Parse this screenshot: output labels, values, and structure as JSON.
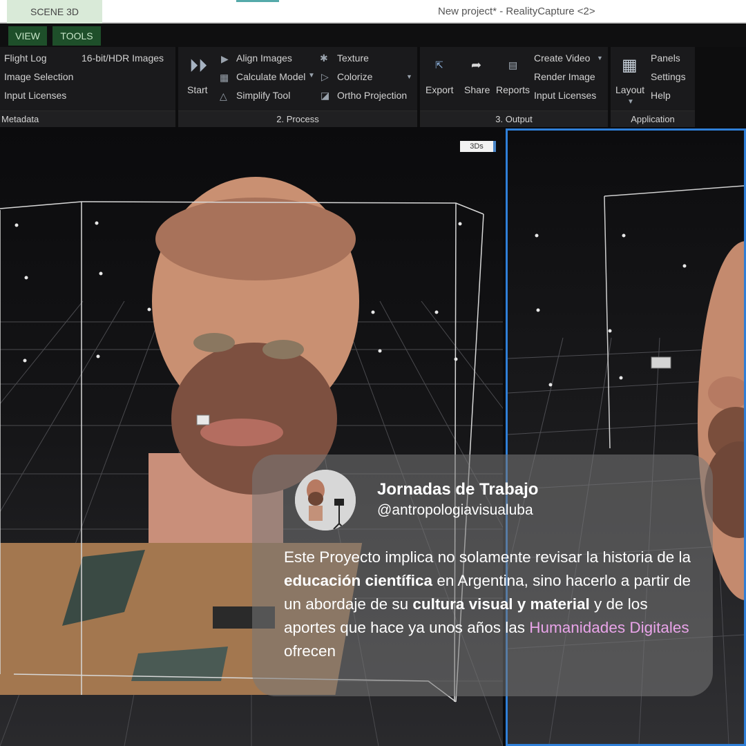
{
  "window": {
    "scene_tab": "SCENE 3D",
    "title": "New project* - RealityCapture <2>"
  },
  "menu": {
    "view": "VIEW",
    "tools": "TOOLS"
  },
  "ribbon": {
    "metadata": {
      "items": [
        "Flight Log",
        "Image Selection",
        "Input Licenses",
        "16-bit/HDR Images"
      ],
      "label": "Metadata"
    },
    "process": {
      "start": "Start",
      "items": [
        "Align Images",
        "Calculate Model",
        "Simplify Tool",
        "Texture",
        "Colorize",
        "Ortho Projection"
      ],
      "label": "2. Process"
    },
    "output": {
      "export": "Export",
      "share": "Share",
      "reports": "Reports",
      "items": [
        "Create Video",
        "Render Image",
        "Input Licenses"
      ],
      "label": "3. Output"
    },
    "application": {
      "layout": "Layout",
      "items": [
        "Panels",
        "Settings",
        "Help"
      ],
      "label": "Application"
    }
  },
  "viewport": {
    "badge": "3Ds"
  },
  "card": {
    "title": "Jornadas de Trabajo",
    "handle": "@antropologiavisualuba",
    "body": {
      "t1": "Este Proyecto implica no solamente revisar la historia de la ",
      "b1": "educación científica",
      "t2": " en Argentina, sino hacerlo a partir de un abordaje de su ",
      "b2": "cultura visual y material",
      "t3": " y de los aportes que hace ya unos años las ",
      "h1": "Humanidades Digitales",
      "t4": " ofrecen"
    }
  },
  "colors": {
    "selection_border": "#2f7fd8",
    "ribbon_bg": "#1a1a1c",
    "menu_green": "#1e4f2a",
    "highlight_pink": "#e9a4e9"
  }
}
